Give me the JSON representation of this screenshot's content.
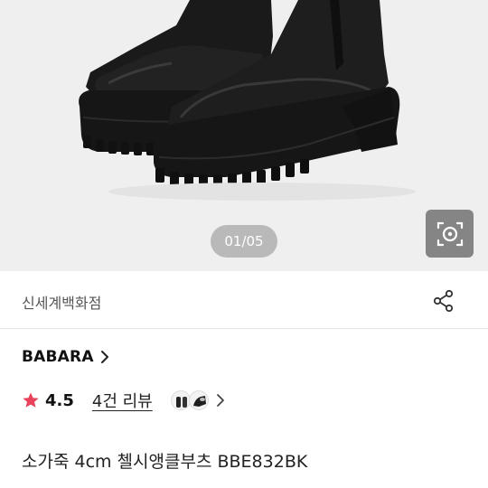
{
  "gallery": {
    "indicator": "01/05"
  },
  "store": {
    "name": "신세계백화점"
  },
  "brand": {
    "name": "BABARA"
  },
  "rating": {
    "score": "4.5",
    "review_link": "4건 리뷰"
  },
  "product": {
    "name": "소가죽 4cm 첼시앵클부츠 BBE832BK"
  },
  "colors": {
    "star": "#e8435a",
    "hero_bg": "#efefef",
    "indicator_bg": "#8c8c8c",
    "boot": "#1c1c1c"
  },
  "icons": {
    "camera_search": "camera-search-icon",
    "share": "share-icon",
    "brand_chevron": "chevron-right-icon",
    "star": "star-icon"
  }
}
